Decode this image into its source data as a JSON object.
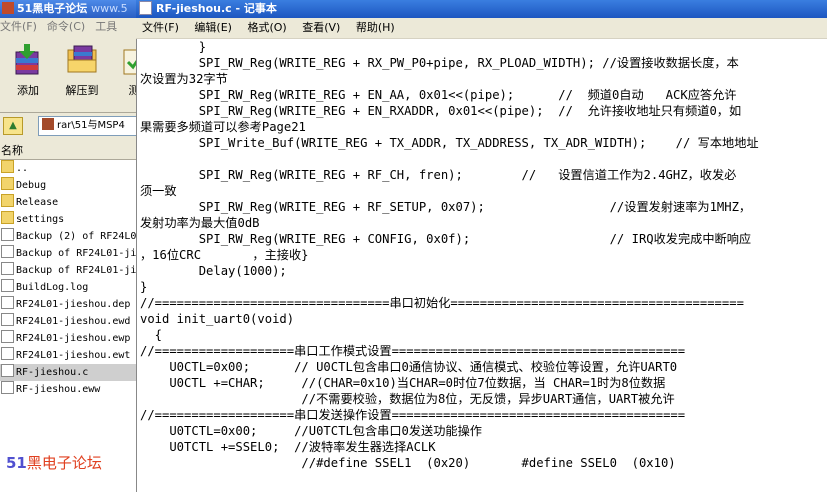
{
  "winrar": {
    "title": "51黑电子论坛",
    "title_sub": "www.5",
    "menu": [
      "文件(F)",
      "命令(C)",
      "工具"
    ],
    "toolbar": [
      {
        "label": "添加",
        "icon": "add-archive-icon"
      },
      {
        "label": "解压到",
        "icon": "extract-to-icon"
      },
      {
        "label": "测",
        "icon": "test-icon"
      }
    ],
    "address": "rar\\51与MSP4",
    "column_header": "名称",
    "files": [
      {
        "name": "..",
        "type": "up"
      },
      {
        "name": "Debug",
        "type": "dir"
      },
      {
        "name": "Release",
        "type": "dir"
      },
      {
        "name": "settings",
        "type": "dir"
      },
      {
        "name": "Backup (2) of RF24L0",
        "type": "file"
      },
      {
        "name": "Backup of RF24L01-ji",
        "type": "file"
      },
      {
        "name": "Backup of RF24L01-ji",
        "type": "file"
      },
      {
        "name": "BuildLog.log",
        "type": "file"
      },
      {
        "name": "RF24L01-jieshou.dep",
        "type": "file"
      },
      {
        "name": "RF24L01-jieshou.ewd",
        "type": "file"
      },
      {
        "name": "RF24L01-jieshou.ewp",
        "type": "file"
      },
      {
        "name": "RF24L01-jieshou.ewt",
        "type": "file"
      },
      {
        "name": "RF-jieshou.c",
        "type": "file",
        "selected": true
      },
      {
        "name": "RF-jieshou.eww",
        "type": "file"
      }
    ],
    "logo": {
      "num": "51",
      "text": "黑电子论坛"
    }
  },
  "notepad": {
    "title": "RF-jieshou.c - 记事本",
    "menu": [
      "文件(F)",
      "编辑(E)",
      "格式(O)",
      "查看(V)",
      "帮助(H)"
    ],
    "lines": [
      "        }",
      "        SPI_RW_Reg(WRITE_REG + RX_PW_P0+pipe, RX_PLOAD_WIDTH); //设置接收数据长度，本",
      "次设置为32字节",
      "        SPI_RW_Reg(WRITE_REG + EN_AA, 0x01<<(pipe);      //  频道0自动   ACK应答允许",
      "        SPI_RW_Reg(WRITE_REG + EN_RXADDR, 0x01<<(pipe);  //  允许接收地址只有频道0，如",
      "果需要多频道可以参考Page21",
      "        SPI_Write_Buf(WRITE_REG + TX_ADDR, TX_ADDRESS, TX_ADR_WIDTH);    // 写本地地址",
      "",
      "        SPI_RW_Reg(WRITE_REG + RF_CH, fren);        //   设置信道工作为2.4GHZ，收发必",
      "须一致",
      "        SPI_RW_Reg(WRITE_REG + RF_SETUP, 0x07);                 //设置发射速率为1MHZ，",
      "发射功率为最大值0dB",
      "        SPI_RW_Reg(WRITE_REG + CONFIG, 0x0f);                   // IRQ收发完成中断响应",
      "，16位CRC       ，主接收}",
      "        Delay(1000);",
      "}",
      "//================================串口初始化========================================",
      "void init_uart0(void)",
      "  {",
      "//===================串口工作模式设置========================================",
      "    U0CTL=0x00;      // U0CTL包含串口0通信协议、通信模式、校验位等设置，允许UART0",
      "    U0CTL +=CHAR;     //(CHAR=0x10)当CHAR=0时位7位数据，当 CHAR=1时为8位数据",
      "                      //不需要校验，数据位为8位，无反馈，异步UART通信，UART被允许",
      "//===================串口发送操作设置========================================",
      "    U0TCTL=0x00;     //U0TCTL包含串口0发送功能操作",
      "    U0TCTL +=SSEL0;  //波特率发生器选择ACLK",
      "                      //#define SSEL1  (0x20)       #define SSEL0  (0x10)"
    ]
  }
}
